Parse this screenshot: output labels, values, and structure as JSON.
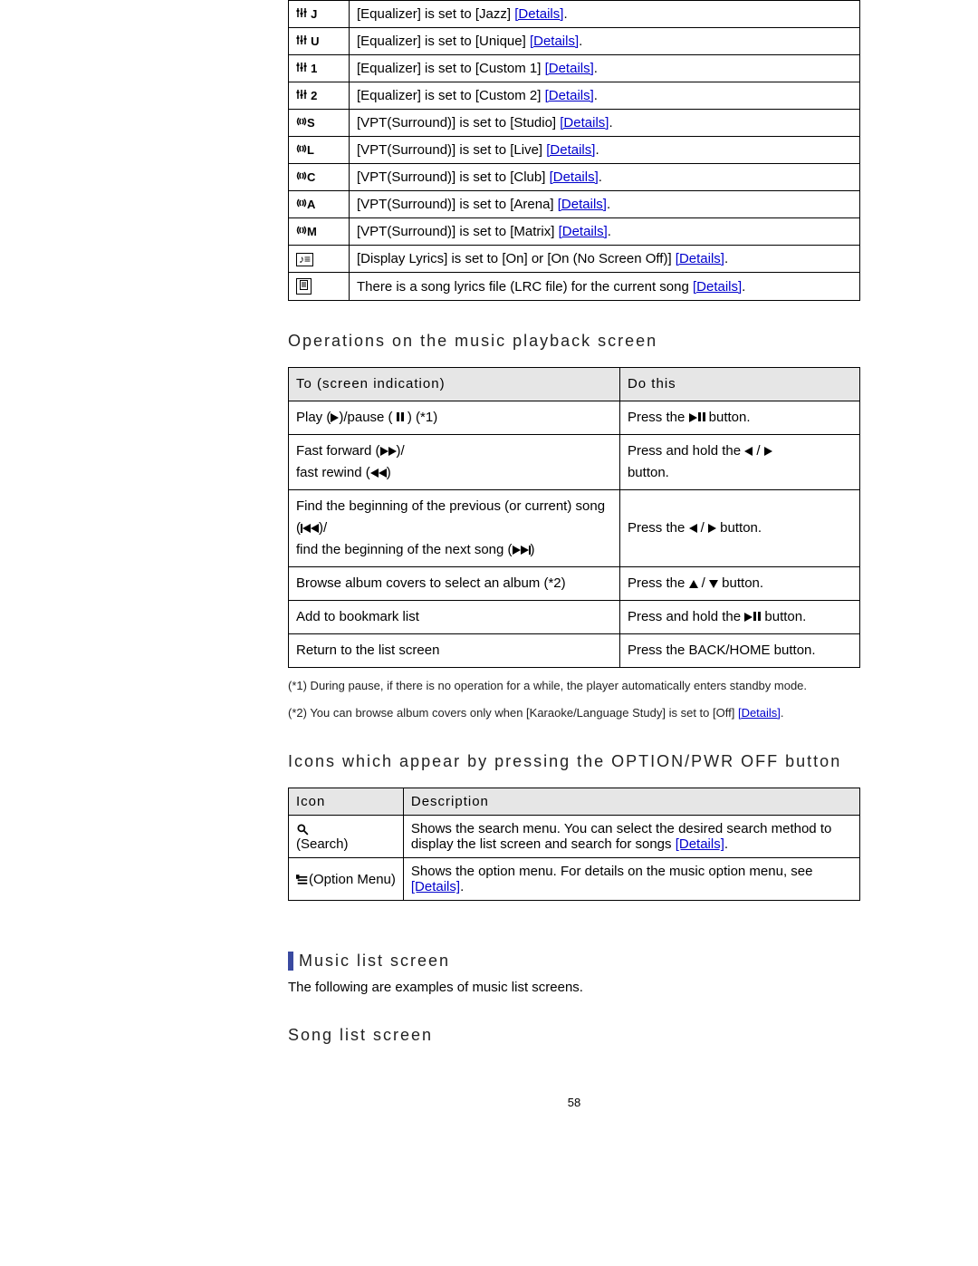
{
  "status_rows": [
    {
      "icon_label": "J",
      "icon_type": "eq",
      "text": "[Equalizer] is set to [Jazz] ",
      "link": "[Details]",
      "tail": "."
    },
    {
      "icon_label": "U",
      "icon_type": "eq",
      "text": "[Equalizer] is set to [Unique] ",
      "link": "[Details]",
      "tail": "."
    },
    {
      "icon_label": "1",
      "icon_type": "eq",
      "text": "[Equalizer] is set to [Custom 1] ",
      "link": "[Details]",
      "tail": "."
    },
    {
      "icon_label": "2",
      "icon_type": "eq",
      "text": "[Equalizer] is set to [Custom 2] ",
      "link": "[Details]",
      "tail": "."
    },
    {
      "icon_label": "S",
      "icon_type": "vpt",
      "text": "[VPT(Surround)] is set to [Studio] ",
      "link": "[Details]",
      "tail": "."
    },
    {
      "icon_label": "L",
      "icon_type": "vpt",
      "text": "[VPT(Surround)] is set to [Live] ",
      "link": "[Details]",
      "tail": "."
    },
    {
      "icon_label": "C",
      "icon_type": "vpt",
      "text": "[VPT(Surround)] is set to [Club] ",
      "link": "[Details]",
      "tail": "."
    },
    {
      "icon_label": "A",
      "icon_type": "vpt",
      "text": "[VPT(Surround)] is set to [Arena] ",
      "link": "[Details]",
      "tail": "."
    },
    {
      "icon_label": "M",
      "icon_type": "vpt",
      "text": "[VPT(Surround)] is set to [Matrix] ",
      "link": "[Details]",
      "tail": "."
    },
    {
      "icon_label": "lyrics",
      "icon_type": "box-music",
      "text": "[Display Lyrics] is set to [On] or [On (No Screen Off)] ",
      "link": "[Details]",
      "tail": "."
    },
    {
      "icon_label": "lrc",
      "icon_type": "box-doc",
      "text": "There is a song lyrics file (LRC file) for the current song ",
      "link": "[Details]",
      "tail": "."
    }
  ],
  "heading_ops": "Operations on the music playback screen",
  "ops_header_left": "To (screen indication)",
  "ops_header_right": "Do this",
  "ops_rows": {
    "r1_left_a": "Play (",
    "r1_left_b": ")/pause (",
    "r1_left_c": " ) (*1)",
    "r1_right_a": "Press the ",
    "r1_right_b": " button.",
    "r2_left_a": "Fast forward (",
    "r2_left_b": ")/",
    "r2_left_c": "fast rewind (",
    "r2_left_d": ")",
    "r2_right_a": "Press and hold the ",
    "r2_right_b": " / ",
    "r2_right_c": " button.",
    "r3_left_a": "Find the beginning of the previous (or current) song (",
    "r3_left_b": ")/",
    "r3_left_c": "find the beginning of the next song (",
    "r3_left_d": ")",
    "r3_right_a": "Press the ",
    "r3_right_b": " / ",
    "r3_right_c": " button.",
    "r4_left": "Browse album covers to select an album (*2)",
    "r4_right_a": "Press the ",
    "r4_right_b": " / ",
    "r4_right_c": " button.",
    "r5_left": "Add to bookmark list",
    "r5_right_a": "Press and hold the ",
    "r5_right_b": " button.",
    "r6_left": "Return to the list screen",
    "r6_right": "Press the BACK/HOME button."
  },
  "footnote1": "(*1) During pause, if there is no operation for a while, the player automatically enters standby mode.",
  "footnote2_a": "(*2) You can browse album covers only when [Karaoke/Language Study] is set to [Off] ",
  "footnote2_link": "[Details]",
  "footnote2_b": ".",
  "heading_icons": "Icons which appear by pressing the OPTION/PWR OFF button",
  "icons_header_left": "Icon",
  "icons_header_right": "Description",
  "icons_rows": {
    "search_label": "(Search)",
    "search_desc_a": "Shows the search menu. You can select the desired search method to display the list screen and search for songs ",
    "search_link": "[Details]",
    "search_tail": ".",
    "option_label": "(Option Menu)",
    "option_desc_a": "Shows the option menu. For details on the music option menu, see ",
    "option_link": "[Details]",
    "option_tail": "."
  },
  "heading_list": "Music list screen",
  "list_intro": "The following are examples of music list screens.",
  "heading_song": "Song list screen",
  "page_number": "58"
}
